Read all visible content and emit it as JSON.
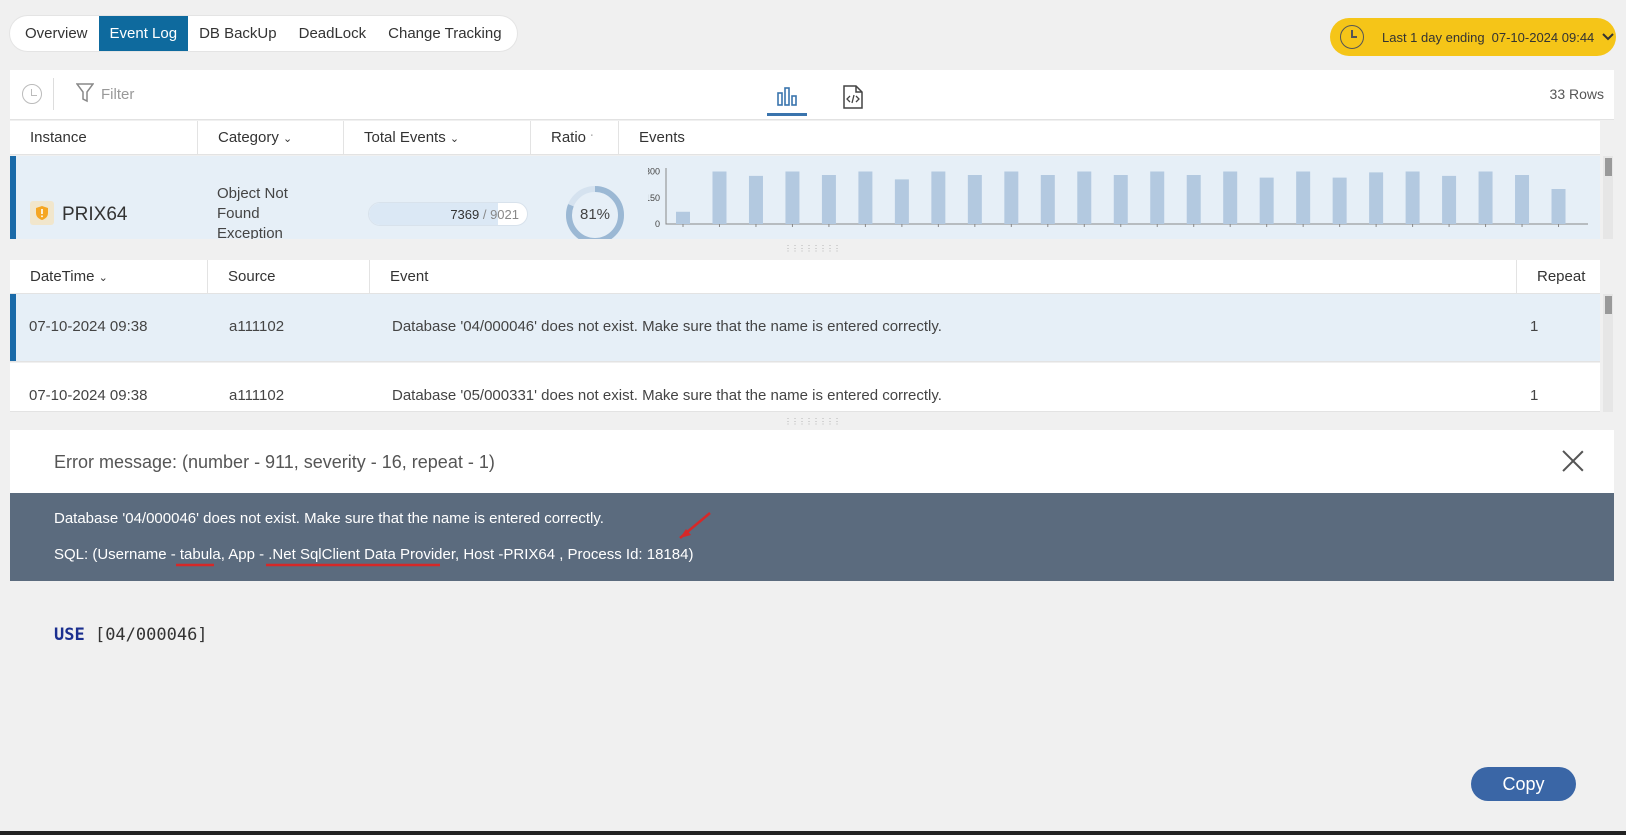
{
  "tabs": [
    {
      "label": "Overview",
      "active": false
    },
    {
      "label": "Event Log",
      "active": true
    },
    {
      "label": "DB BackUp",
      "active": false
    },
    {
      "label": "DeadLock",
      "active": false
    },
    {
      "label": "Change Tracking",
      "active": false
    }
  ],
  "time_range": {
    "label": "Last 1 day ending",
    "value": "07-10-2024 09:44",
    "icon": "clock-icon",
    "color": "#f5c518"
  },
  "toolbar": {
    "filter_placeholder": "Filter",
    "rows_count": "33 Rows"
  },
  "instance_grid": {
    "columns": [
      "Instance",
      "Category",
      "Total Events",
      "Ratio",
      "Events"
    ],
    "row": {
      "instance": "PRIX64",
      "category": "Object Not Found Exception",
      "events": "7369",
      "total": "9021",
      "events_separator": " / ",
      "ratio": "81%",
      "ratio_value": 0.81
    }
  },
  "chart_data": {
    "type": "bar",
    "yticks": [
      "300",
      "150",
      "0"
    ],
    "ylim": [
      0,
      320
    ],
    "values": [
      70,
      300,
      275,
      300,
      280,
      300,
      255,
      300,
      280,
      300,
      280,
      300,
      280,
      300,
      280,
      300,
      265,
      300,
      265,
      295,
      300,
      275,
      300,
      280,
      200
    ],
    "color": "#b3c9e0"
  },
  "event_grid": {
    "columns": [
      "DateTime",
      "Source",
      "Event",
      "Repeat"
    ],
    "rows": [
      {
        "datetime": "07-10-2024 09:38",
        "source": "a111102",
        "event": "Database '04/000046' does not exist. Make sure that the name is entered correctly.",
        "repeat": "1"
      },
      {
        "datetime": "07-10-2024 09:38",
        "source": "a111102",
        "event": "Database '05/000331' does not exist. Make sure that the name is entered correctly.",
        "repeat": "1"
      }
    ]
  },
  "detail": {
    "title": "Error message: (number - 911, severity - 16, repeat - 1)",
    "message": "Database '04/000046' does not exist. Make sure that the name is entered correctly.",
    "sql_info": "SQL: (Username - tabula, App - .Net SqlClient Data Provider, Host -PRIX64  , Process Id: 18184)",
    "sql_keyword": "USE",
    "sql_rest": " [04/000046]",
    "copy_label": "Copy"
  }
}
